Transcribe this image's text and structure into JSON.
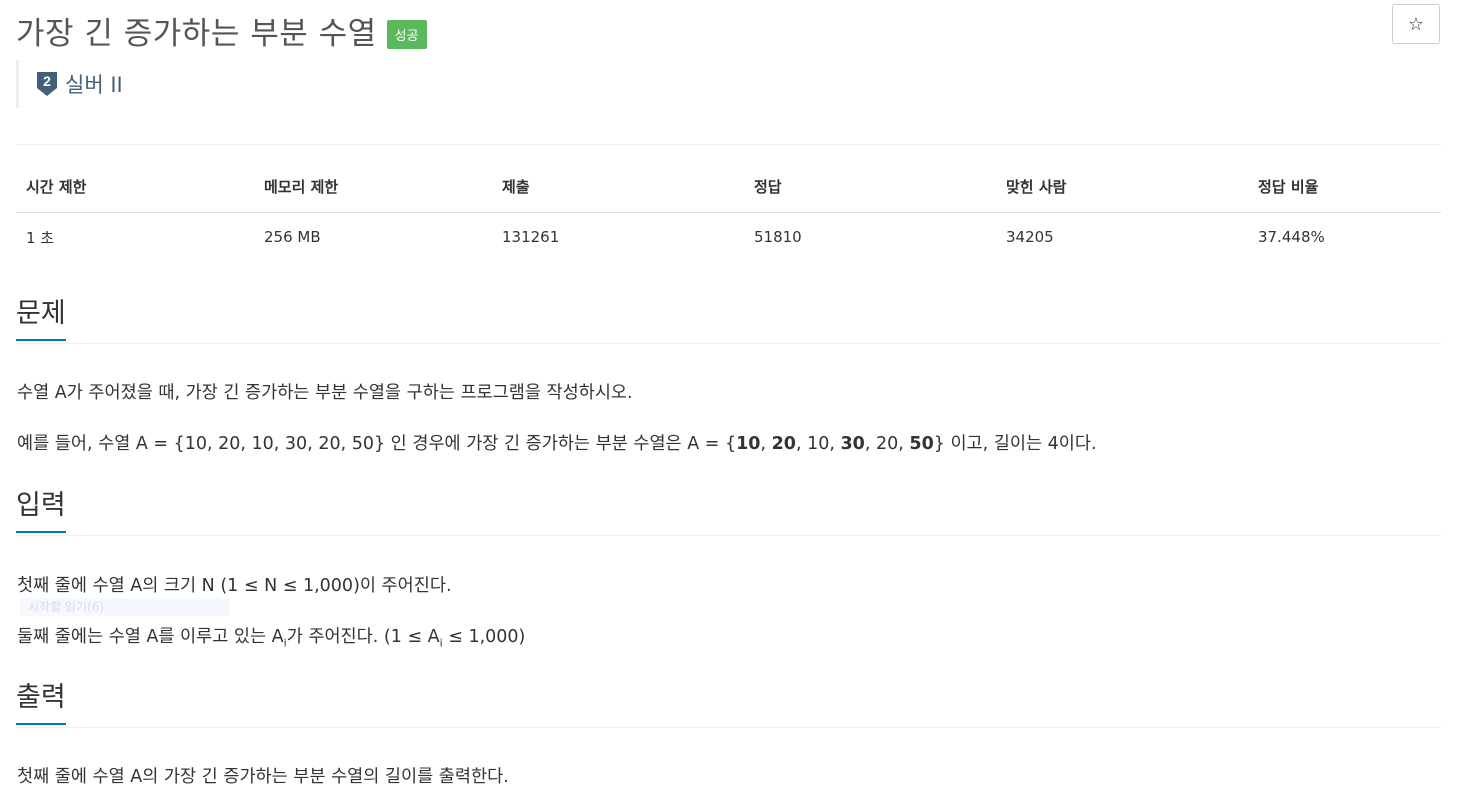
{
  "problem": {
    "title": "가장 긴 증가하는 부분 수열",
    "badge": "성공",
    "favorite_icon": "☆",
    "tier_level": "2",
    "tier_label": "실버 II"
  },
  "stats": {
    "headers": [
      "시간 제한",
      "메모리 제한",
      "제출",
      "정답",
      "맞힌 사람",
      "정답 비율"
    ],
    "values": [
      "1 초",
      "256 MB",
      "131261",
      "51810",
      "34205",
      "37.448%"
    ]
  },
  "sections": {
    "description": {
      "heading": "문제",
      "line1": "수열 A가 주어졌을 때, 가장 긴 증가하는 부분 수열을 구하는 프로그램을 작성하시오.",
      "line2_prefix": "예를 들어, 수열 A = {10, 20, 10, 30, 20, 50} 인 경우에 가장 긴 증가하는 부분 수열은 A = {",
      "bold_10": "10",
      "bold_20": "20",
      "sep1": ", ",
      "sep2": ", 10, ",
      "bold_30": "30",
      "sep3": ", 20, ",
      "bold_50": "50",
      "line2_suffix": "} 이고, 길이는 4이다."
    },
    "input": {
      "heading": "입력",
      "line1": "첫째 줄에 수열 A의 크기 N (1 ≤ N ≤ 1,000)이 주어진다.",
      "line2_prefix": "둘째 줄에는 수열 A를 이루고 있는 A",
      "line2_sub": "i",
      "line2_mid": "가 주어진다. (1 ≤ A",
      "line2_sub2": "i",
      "line2_suffix": " ≤ 1,000)",
      "ghost_text": "시작할 읽기(6)"
    },
    "output": {
      "heading": "출력",
      "line1": "첫째 줄에 수열 A의 가장 긴 증가하는 부분 수열의 길이를 출력한다."
    }
  },
  "colors": {
    "badge_green": "#5cb85c",
    "tier_silver": "#435f7a",
    "accent_blue": "#0076c0"
  }
}
